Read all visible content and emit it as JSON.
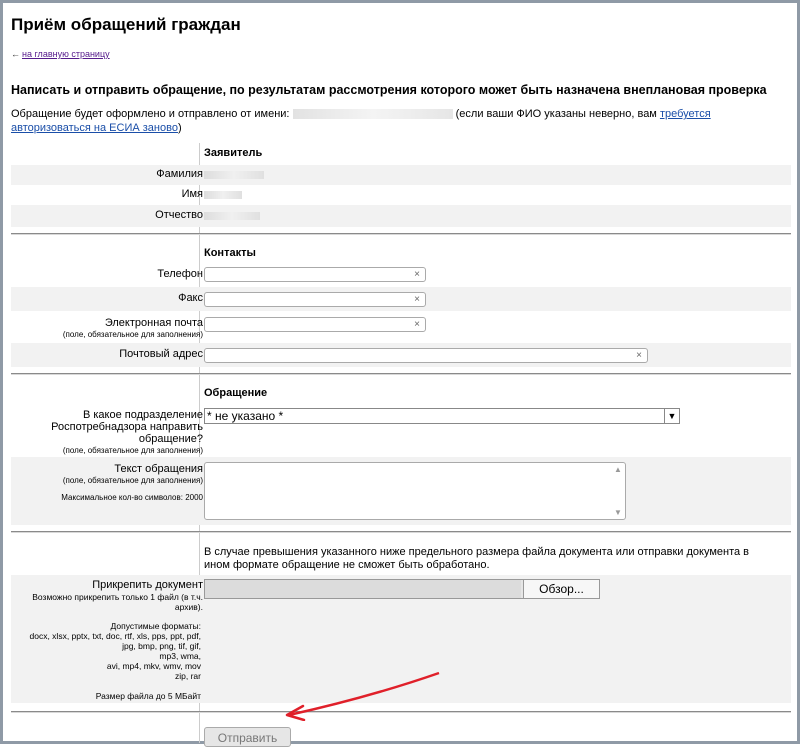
{
  "page": {
    "title": "Приём обращений граждан",
    "back_link": "на главную страницу",
    "subtitle": "Написать и отправить обращение, по результатам рассмотрения которого может быть назначена внеплановая проверка",
    "intro_prefix": "Обращение будет оформлено и отправлено от имени:",
    "intro_mid": "(если ваши ФИО указаны неверно, вам",
    "intro_link": "требуется авторизоваться на ЕСИА заново",
    "intro_suffix": ")"
  },
  "applicant": {
    "section": "Заявитель",
    "surname_label": "Фамилия",
    "name_label": "Имя",
    "patronymic_label": "Отчество"
  },
  "contacts": {
    "section": "Контакты",
    "phone_label": "Телефон",
    "fax_label": "Факс",
    "email_label": "Электронная почта",
    "email_note": "(поле, обязательное для заполнения)",
    "address_label": "Почтовый адрес",
    "clear_symbol": "×"
  },
  "appeal": {
    "section": "Обращение",
    "department_label": "В какое подразделение Роспотребнадзора направить обращение?",
    "department_note": "(поле, обязательное для заполнения)",
    "department_value": "* не указано *",
    "text_label": "Текст обращения",
    "text_note": "(поле, обязательное для заполнения)",
    "text_max": "Максимальное кол-во символов: 2000"
  },
  "attachment": {
    "warning": "В случае превышения указанного ниже предельного размера файла документа или отправки документа в ином формате обращение не сможет быть обработано.",
    "label": "Прикрепить документ",
    "note": "Возможно прикрепить только 1 файл (в т.ч. архив).",
    "formats_title": "Допустимые форматы:",
    "formats_1": "docx, xlsx, pptx, txt, doc, rtf, xls, pps, ppt, pdf,",
    "formats_2": "jpg, bmp, png, tif, gif,",
    "formats_3": "mp3, wma,",
    "formats_4": "avi, mp4, mkv, wmv, mov",
    "formats_5": "zip, rar",
    "size_limit": "Размер файла до 5 МБайт",
    "browse_label": "Обзор..."
  },
  "submit": {
    "label": "Отправить"
  },
  "colors": {
    "arrow": "#e0202a",
    "link": "#1a4ea8",
    "visited": "#551a8b"
  }
}
